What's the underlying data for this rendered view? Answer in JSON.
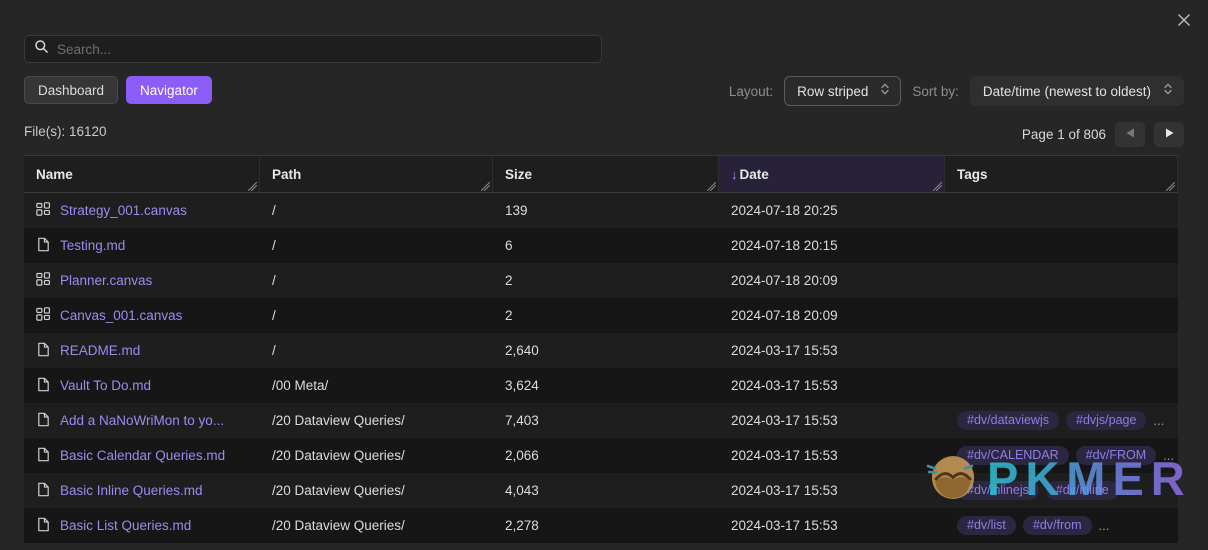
{
  "window": {
    "close_icon": "close-icon"
  },
  "search": {
    "placeholder": "Search...",
    "value": "",
    "icon": "search-icon"
  },
  "view_buttons": [
    {
      "label": "Dashboard",
      "active": false
    },
    {
      "label": "Navigator",
      "active": true
    }
  ],
  "controls": {
    "layout_label": "Layout:",
    "layout_value": "Row striped",
    "sort_label": "Sort by:",
    "sort_value": "Date/time (newest to oldest)"
  },
  "status": {
    "file_count_label": "File(s): 16120",
    "page_label": "Page 1 of 806",
    "prev_icon": "triangle-left-icon",
    "next_icon": "triangle-right-icon"
  },
  "table": {
    "columns": [
      {
        "key": "name",
        "label": "Name",
        "sorted": false
      },
      {
        "key": "path",
        "label": "Path",
        "sorted": false
      },
      {
        "key": "size",
        "label": "Size",
        "sorted": false
      },
      {
        "key": "date",
        "label": "Date",
        "sorted": true,
        "sort_arrow": "↓"
      },
      {
        "key": "tags",
        "label": "Tags",
        "sorted": false
      }
    ],
    "rows": [
      {
        "icon": "canvas-icon",
        "name": "Strategy_001.canvas",
        "path": "/",
        "size": "139",
        "date": "2024-07-18 20:25",
        "tags": [],
        "more": false
      },
      {
        "icon": "document-icon",
        "name": "Testing.md",
        "path": "/",
        "size": "6",
        "date": "2024-07-18 20:15",
        "tags": [],
        "more": false
      },
      {
        "icon": "canvas-icon",
        "name": "Planner.canvas",
        "path": "/",
        "size": "2",
        "date": "2024-07-18 20:09",
        "tags": [],
        "more": false
      },
      {
        "icon": "canvas-icon",
        "name": "Canvas_001.canvas",
        "path": "/",
        "size": "2",
        "date": "2024-07-18 20:09",
        "tags": [],
        "more": false
      },
      {
        "icon": "document-icon",
        "name": "README.md",
        "path": "/",
        "size": "2,640",
        "date": "2024-03-17 15:53",
        "tags": [],
        "more": false
      },
      {
        "icon": "document-icon",
        "name": "Vault To Do.md",
        "path": "/00 Meta/",
        "size": "3,624",
        "date": "2024-03-17 15:53",
        "tags": [],
        "more": false
      },
      {
        "icon": "document-icon",
        "name": "Add a NaNoWriMon to yo...",
        "path": "/20 Dataview Queries/",
        "size": "7,403",
        "date": "2024-03-17 15:53",
        "tags": [
          "#dv/dataviewjs",
          "#dvjs/page"
        ],
        "more": true
      },
      {
        "icon": "document-icon",
        "name": "Basic Calendar Queries.md",
        "path": "/20 Dataview Queries/",
        "size": "2,066",
        "date": "2024-03-17 15:53",
        "tags": [
          "#dv/CALENDAR",
          "#dv/FROM"
        ],
        "more": true
      },
      {
        "icon": "document-icon",
        "name": "Basic Inline Queries.md",
        "path": "/20 Dataview Queries/",
        "size": "4,043",
        "date": "2024-03-17 15:53",
        "tags": [
          "#dv/inlinejs",
          "#dv/inline"
        ],
        "more": true
      },
      {
        "icon": "document-icon",
        "name": "Basic List Queries.md",
        "path": "/20 Dataview Queries/",
        "size": "2,278",
        "date": "2024-03-17 15:53",
        "tags": [
          "#dv/list",
          "#dv/from"
        ],
        "more": true
      }
    ],
    "more_label": "..."
  },
  "watermark": {
    "text": "PKMER",
    "logo": "pkmer-owl-logo"
  },
  "colors": {
    "accent": "#8b5cf6",
    "link": "#9b8cf0",
    "tag_bg": "#2c2740",
    "tag_text": "#8d7ee8",
    "row_odd": "#1e1e1e",
    "row_even": "#161616",
    "sorted_header_bg": "#27223a",
    "page_bg": "#262626"
  }
}
